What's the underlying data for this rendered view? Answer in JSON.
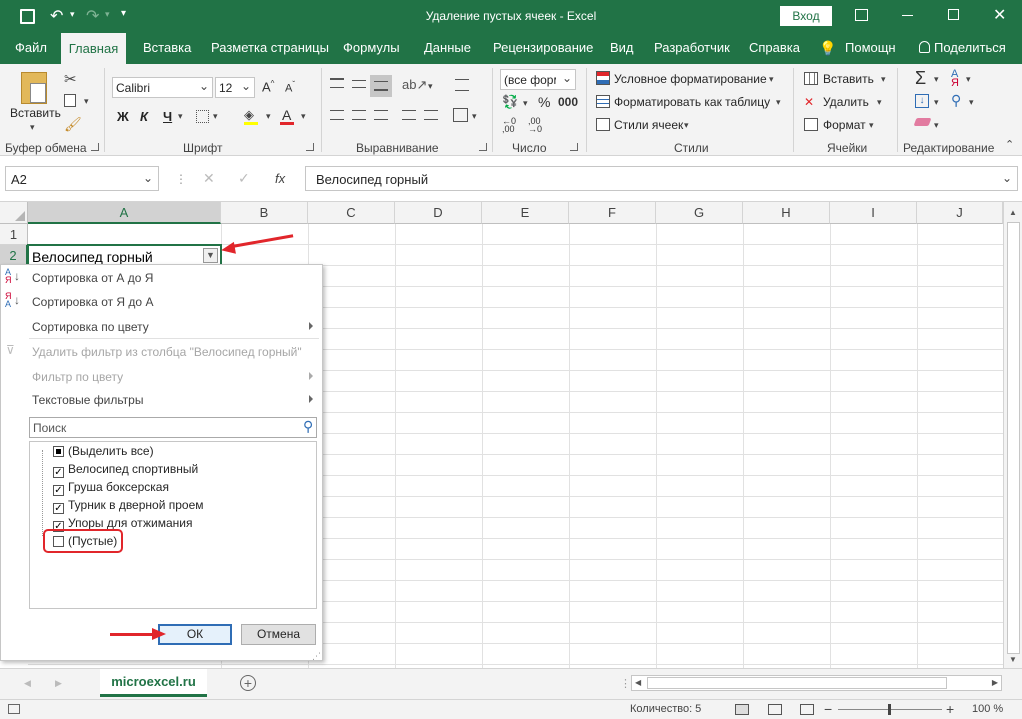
{
  "window": {
    "title": "Удаление пустых ячеек  -  Excel",
    "login_label": "Вход"
  },
  "tabs": [
    "Файл",
    "Главная",
    "Вставка",
    "Разметка страницы",
    "Формулы",
    "Данные",
    "Рецензирование",
    "Вид",
    "Разработчик",
    "Справка",
    "Помощн",
    "Поделиться"
  ],
  "ribbon": {
    "clipboard": {
      "paste_label": "Вставить",
      "group_label": "Буфер обмена"
    },
    "font": {
      "name": "Calibri",
      "size": "12",
      "bold": "Ж",
      "italic": "К",
      "underline": "Ч",
      "group_label": "Шрифт"
    },
    "alignment": {
      "group_label": "Выравнивание"
    },
    "number": {
      "format": "(все форм",
      "group_label": "Число"
    },
    "styles": {
      "conditional": "Условное форматирование",
      "as_table": "Форматировать как таблицу",
      "cell_styles": "Стили ячеек",
      "group_label": "Стили"
    },
    "cells": {
      "insert": "Вставить",
      "delete": "Удалить",
      "format": "Формат",
      "group_label": "Ячейки"
    },
    "editing": {
      "group_label": "Редактирование"
    }
  },
  "formula_bar": {
    "name_box": "A2",
    "fx": "fx",
    "value": "Велосипед горный"
  },
  "columns": [
    "A",
    "B",
    "C",
    "D",
    "E",
    "F",
    "G",
    "H",
    "I",
    "J"
  ],
  "rows": [
    "1",
    "2"
  ],
  "cell_a2": "Велосипед горный",
  "filter_menu": {
    "sort_az": "Сортировка от А до Я",
    "sort_za": "Сортировка от Я до А",
    "sort_color": "Сортировка по цвету",
    "clear_filter": "Удалить фильтр из столбца \"Велосипед горный\"",
    "filter_color": "Фильтр по цвету",
    "text_filters": "Текстовые фильтры",
    "search_placeholder": "Поиск",
    "items": [
      {
        "label": "(Выделить все)",
        "state": "partial"
      },
      {
        "label": "Велосипед спортивный",
        "state": "checked"
      },
      {
        "label": "Груша боксерская",
        "state": "checked"
      },
      {
        "label": "Турник в дверной проем",
        "state": "checked"
      },
      {
        "label": "Упоры для отжимания",
        "state": "checked"
      },
      {
        "label": "(Пустые)",
        "state": "unchecked"
      }
    ],
    "ok": "ОК",
    "cancel": "Отмена"
  },
  "sheet_tab": "microexcel.ru",
  "status": {
    "count": "Количество: 5",
    "zoom": "100 %"
  },
  "colors": {
    "excel_green": "#217346",
    "annotation_red": "#e1262b"
  }
}
